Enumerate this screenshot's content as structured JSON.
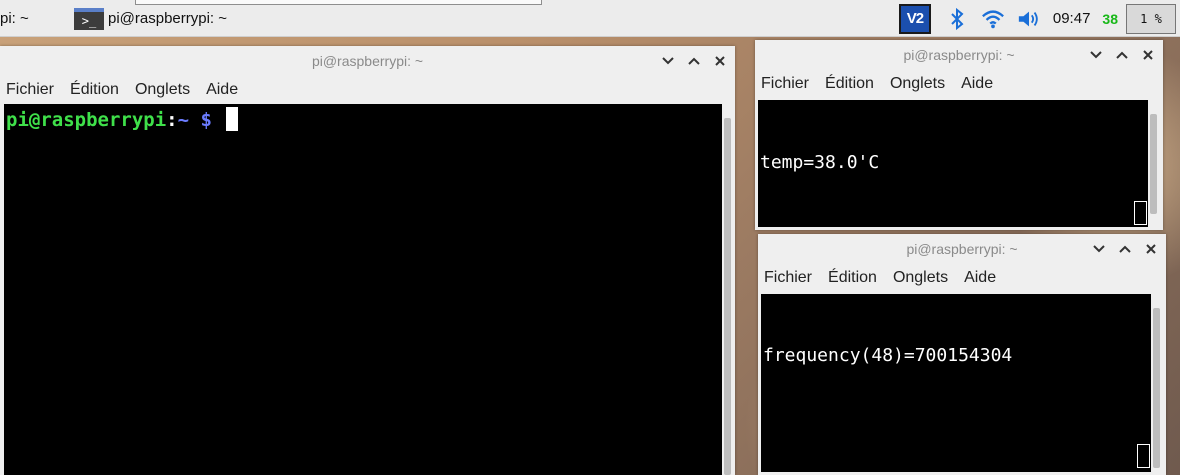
{
  "panel": {
    "prev_task_label": "pi: ~",
    "task_label": "pi@raspberrypi: ~",
    "terminal_glyph": ">_",
    "vnc_label": "V2",
    "time": "09:47",
    "cpu_temp": "38",
    "cpu_usage": "1 %"
  },
  "main_window": {
    "title": "pi@raspberrypi: ~",
    "menu": [
      "Fichier",
      "Édition",
      "Onglets",
      "Aide"
    ],
    "prompt_user": "pi@raspberrypi",
    "prompt_sep": ":",
    "prompt_path": "~ $"
  },
  "temp_window": {
    "title": "pi@raspberrypi: ~",
    "menu": [
      "Fichier",
      "Édition",
      "Onglets",
      "Aide"
    ],
    "output": "temp=38.0'C"
  },
  "freq_window": {
    "title": "pi@raspberrypi: ~",
    "menu": [
      "Fichier",
      "Édition",
      "Onglets",
      "Aide"
    ],
    "output": "frequency(48)=700154304"
  },
  "colors": {
    "prompt_user": "#3fe04a",
    "prompt_path": "#6b7cff",
    "cpu_temp": "#18b818",
    "vnc_bg": "#1b4fae"
  },
  "icons": [
    "terminal-icon",
    "vnc-icon",
    "bluetooth-icon",
    "wifi-icon",
    "volume-icon",
    "chevron-down-icon",
    "chevron-up-icon",
    "close-icon"
  ]
}
